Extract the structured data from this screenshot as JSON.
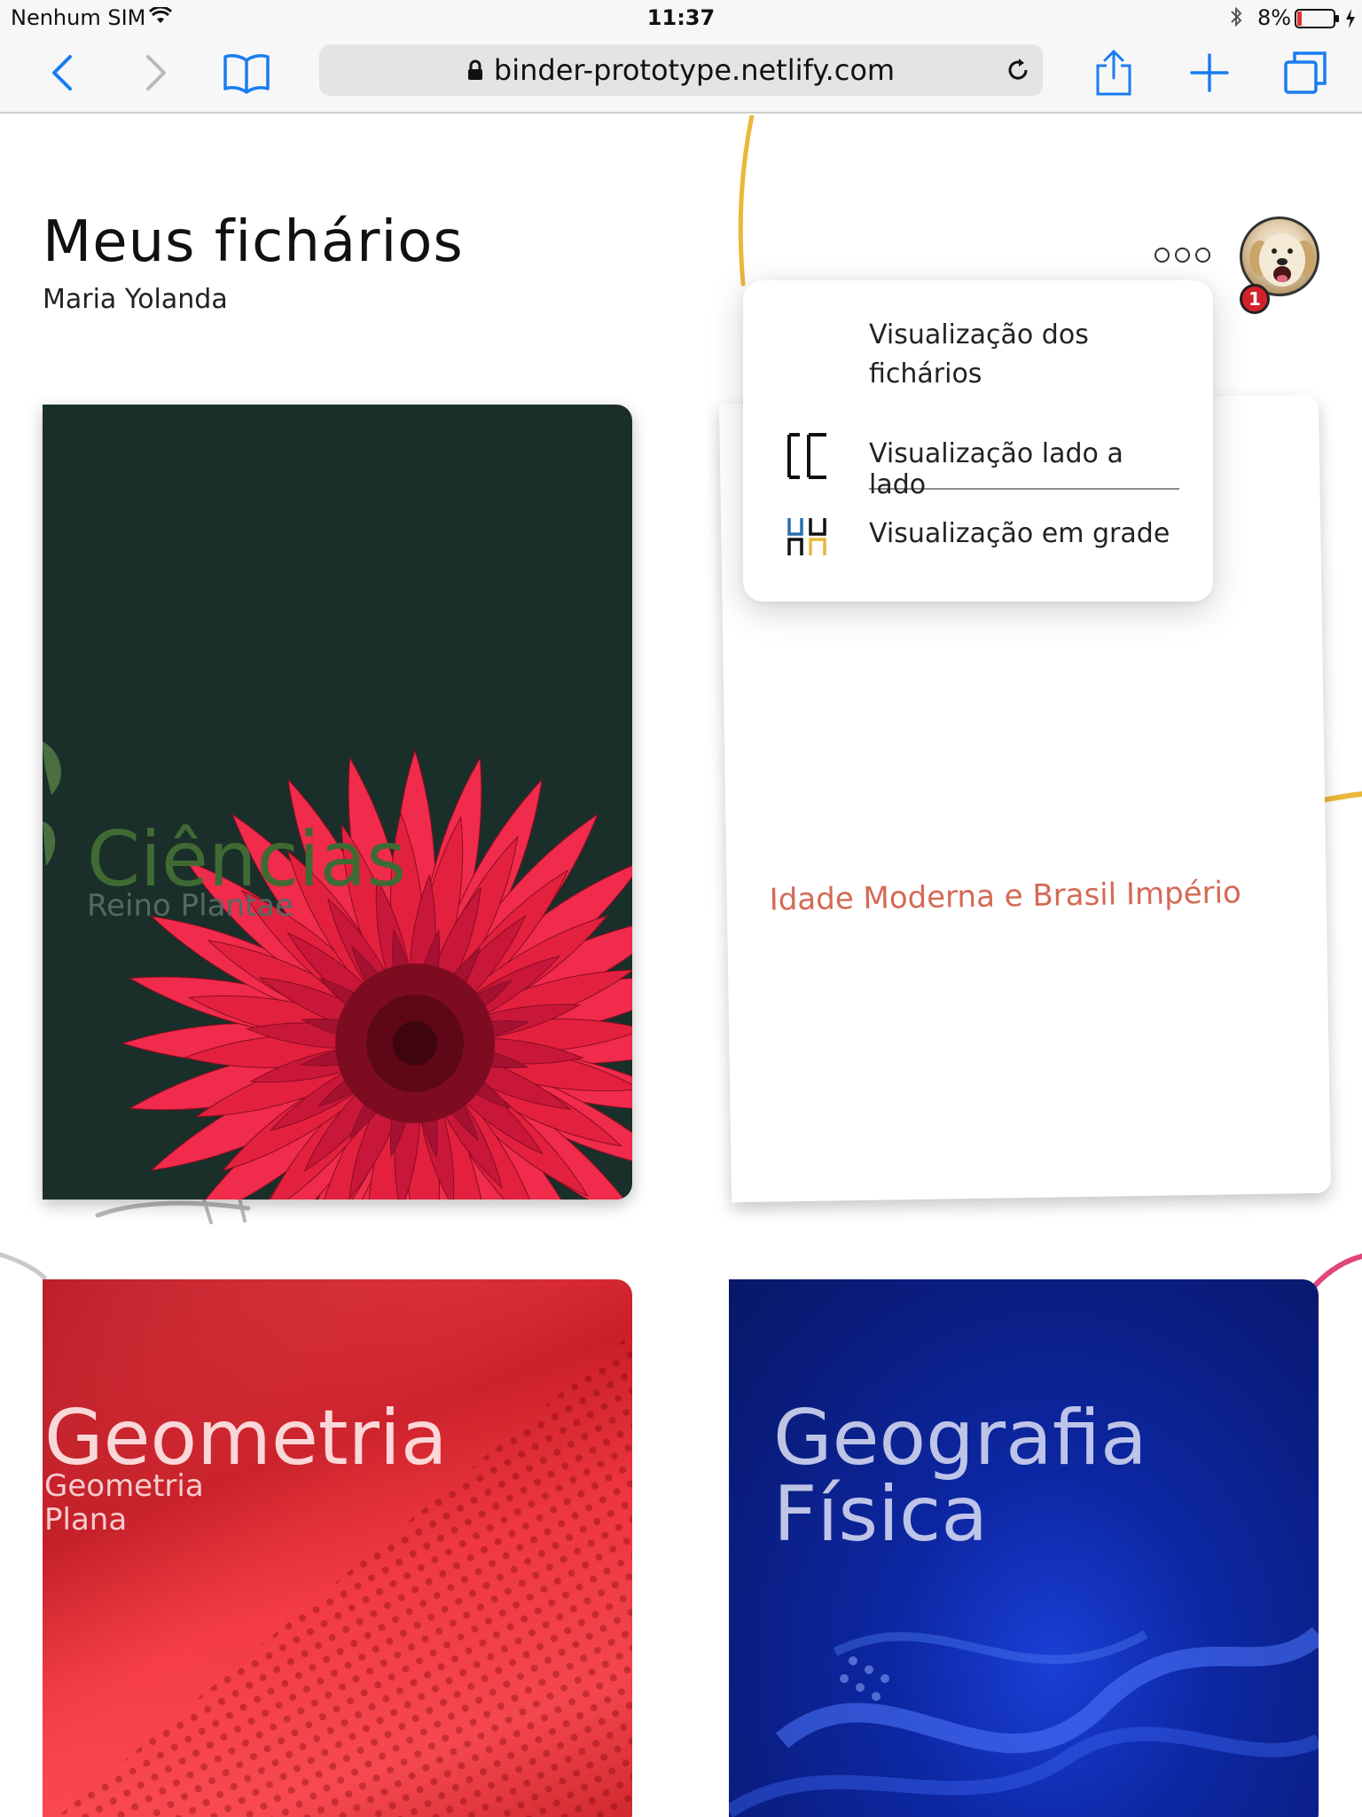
{
  "status": {
    "carrier": "Nenhum SIM",
    "time": "11:37",
    "battery": "8%"
  },
  "browser": {
    "url": "binder-prototype.netlify.com"
  },
  "header": {
    "title": "Meus fichários",
    "user": "Maria Yolanda",
    "notifications": "1"
  },
  "menu": {
    "header": "Visualização dos fichários",
    "side_by_side": "Visualização lado a lado",
    "grid": "Visualização em grade"
  },
  "binders": [
    {
      "title": "Ciências",
      "subtitle": "Reino Plantae",
      "color": "#1b2f2a"
    },
    {
      "title": "Idade Moderna e Brasil Império",
      "color": "#ffffff"
    },
    {
      "title": "Geometria",
      "subtitle": "Geometria Plana",
      "color": "#d7242e"
    },
    {
      "title": "Geografia Física",
      "color": "#0d27a3"
    }
  ],
  "colors": {
    "accent_yellow": "#e9b73a",
    "accent_pink": "#e0477a",
    "link_blue": "#1a7cf0"
  }
}
